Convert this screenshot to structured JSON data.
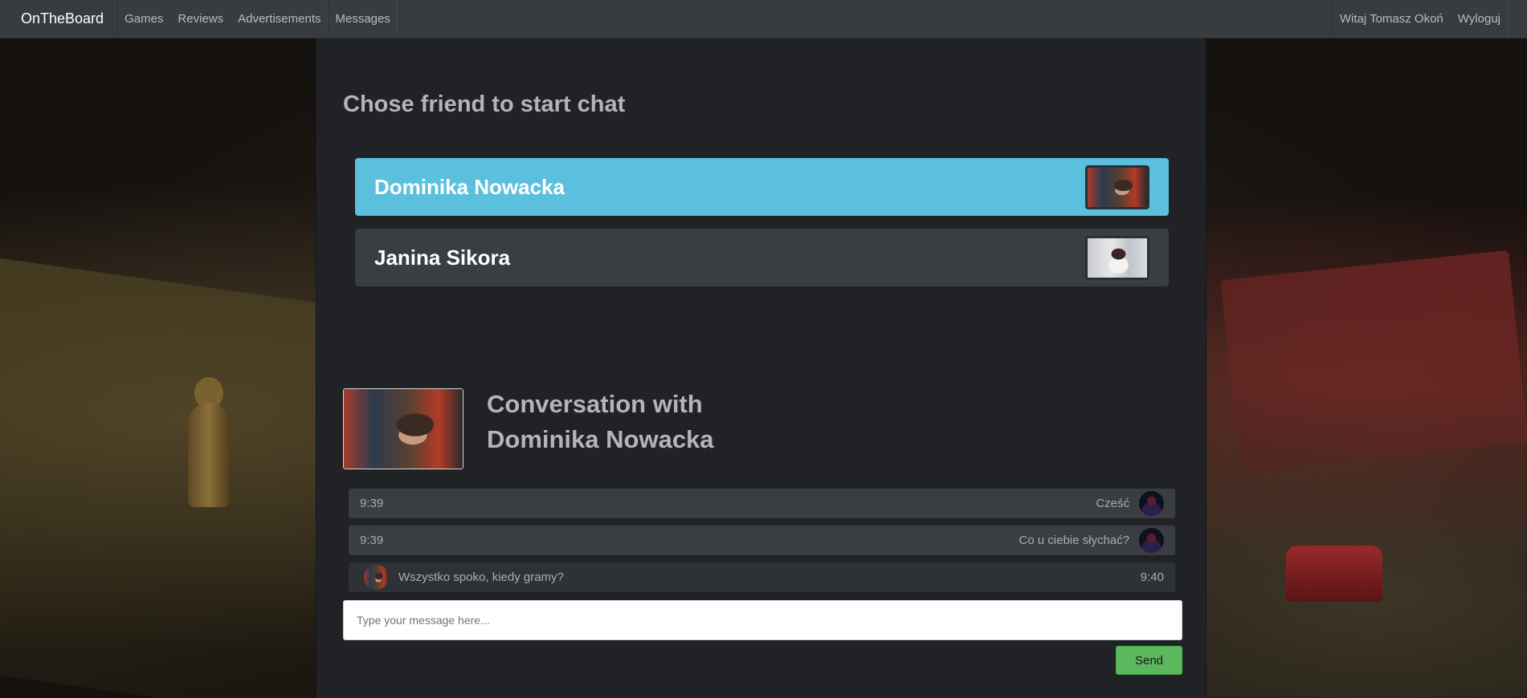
{
  "navbar": {
    "brand": "OnTheBoard",
    "links": [
      "Games",
      "Reviews",
      "Advertisements",
      "Messages"
    ],
    "greeting": "Witaj Tomasz Okoń",
    "logout": "Wyloguj"
  },
  "friends_section": {
    "title": "Chose friend to start chat",
    "friends": [
      {
        "name": "Dominika Nowacka",
        "active": true
      },
      {
        "name": "Janina Sikora",
        "active": false
      }
    ]
  },
  "conversation": {
    "title_line1": "Conversation with",
    "title_line2": "Dominika Nowacka",
    "messages": [
      {
        "time": "9:39",
        "text": "Cześć",
        "direction": "sent"
      },
      {
        "time": "9:39",
        "text": "Co u ciebie słychać?",
        "direction": "sent"
      },
      {
        "time": "9:40",
        "text": "Wszystko spoko, kiedy gramy?",
        "direction": "received"
      }
    ],
    "input_placeholder": "Type your message here...",
    "send_label": "Send"
  },
  "colors": {
    "active_friend": "#5bc0de",
    "send_button": "#5cb85c",
    "navbar": "#383c41",
    "panel": "#202225"
  }
}
